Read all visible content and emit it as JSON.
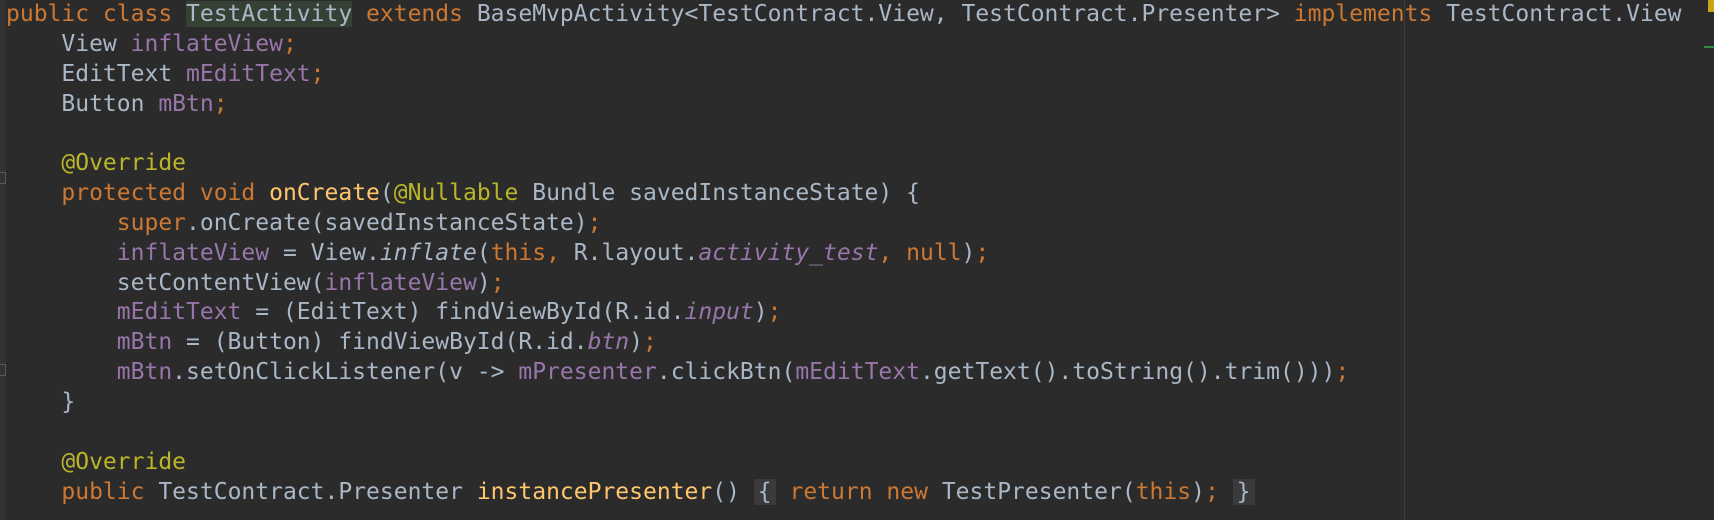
{
  "editor": {
    "caret_line": 1,
    "lines": [
      {
        "tokens": [
          {
            "t": "public class ",
            "c": "kw"
          },
          {
            "t": "",
            "c": "caret"
          },
          {
            "t": "TestActivity",
            "c": "hl-cls"
          },
          {
            "t": " extends ",
            "c": "kw"
          },
          {
            "t": "BaseMvpActivity<TestContract.View, TestContract.Presenter> ",
            "c": "plain"
          },
          {
            "t": "implements ",
            "c": "kw"
          },
          {
            "t": "TestContract.View",
            "c": "plain"
          }
        ]
      },
      {
        "tokens": [
          {
            "t": "    View ",
            "c": "plain"
          },
          {
            "t": "inflateView",
            "c": "fld"
          },
          {
            "t": ";",
            "c": "kw"
          }
        ]
      },
      {
        "tokens": [
          {
            "t": "    EditText ",
            "c": "plain"
          },
          {
            "t": "mEditText",
            "c": "fld"
          },
          {
            "t": ";",
            "c": "kw"
          }
        ]
      },
      {
        "tokens": [
          {
            "t": "    Button ",
            "c": "plain"
          },
          {
            "t": "mBtn",
            "c": "fld"
          },
          {
            "t": ";",
            "c": "kw"
          }
        ]
      },
      {
        "tokens": []
      },
      {
        "tokens": [
          {
            "t": "    @Override",
            "c": "ann"
          }
        ]
      },
      {
        "tokens": [
          {
            "t": "    protected void ",
            "c": "kw"
          },
          {
            "t": "onCreate",
            "c": "mth"
          },
          {
            "t": "(",
            "c": "plain"
          },
          {
            "t": "@Nullable",
            "c": "ann"
          },
          {
            "t": " Bundle savedInstanceState) {",
            "c": "plain"
          }
        ]
      },
      {
        "tokens": [
          {
            "t": "        super",
            "c": "kw"
          },
          {
            "t": ".onCreate(savedInstanceState)",
            "c": "plain"
          },
          {
            "t": ";",
            "c": "kw"
          }
        ]
      },
      {
        "tokens": [
          {
            "t": "        inflateView",
            "c": "fld"
          },
          {
            "t": " = View.",
            "c": "plain"
          },
          {
            "t": "inflate",
            "c": "smeth"
          },
          {
            "t": "(",
            "c": "plain"
          },
          {
            "t": "this",
            "c": "kw"
          },
          {
            "t": ", ",
            "c": "kw"
          },
          {
            "t": "R.layout.",
            "c": "plain"
          },
          {
            "t": "activity_test",
            "c": "stat"
          },
          {
            "t": ", ",
            "c": "kw"
          },
          {
            "t": "null",
            "c": "kw"
          },
          {
            "t": ")",
            "c": "plain"
          },
          {
            "t": ";",
            "c": "kw"
          }
        ]
      },
      {
        "tokens": [
          {
            "t": "        setContentView(",
            "c": "plain"
          },
          {
            "t": "inflateView",
            "c": "fld"
          },
          {
            "t": ")",
            "c": "plain"
          },
          {
            "t": ";",
            "c": "kw"
          }
        ]
      },
      {
        "tokens": [
          {
            "t": "        mEditText",
            "c": "fld"
          },
          {
            "t": " = (EditText) findViewById(R.id.",
            "c": "plain"
          },
          {
            "t": "input",
            "c": "stat"
          },
          {
            "t": ")",
            "c": "plain"
          },
          {
            "t": ";",
            "c": "kw"
          }
        ]
      },
      {
        "tokens": [
          {
            "t": "        mBtn",
            "c": "fld"
          },
          {
            "t": " = (Button) findViewById(R.id.",
            "c": "plain"
          },
          {
            "t": "btn",
            "c": "stat"
          },
          {
            "t": ")",
            "c": "plain"
          },
          {
            "t": ";",
            "c": "kw"
          }
        ]
      },
      {
        "tokens": [
          {
            "t": "        mBtn",
            "c": "fld"
          },
          {
            "t": ".setOnClickListener(v -> ",
            "c": "plain"
          },
          {
            "t": "mPresenter",
            "c": "fld"
          },
          {
            "t": ".clickBtn(",
            "c": "plain"
          },
          {
            "t": "mEditText",
            "c": "fld"
          },
          {
            "t": ".getText().toString().trim()))",
            "c": "plain"
          },
          {
            "t": ";",
            "c": "kw"
          }
        ]
      },
      {
        "tokens": [
          {
            "t": "    }",
            "c": "plain"
          }
        ]
      },
      {
        "tokens": []
      },
      {
        "tokens": [
          {
            "t": "    @Override",
            "c": "ann"
          }
        ]
      },
      {
        "tokens": [
          {
            "t": "    public ",
            "c": "kw"
          },
          {
            "t": "TestContract.Presenter ",
            "c": "plain"
          },
          {
            "t": "instancePresenter",
            "c": "mth"
          },
          {
            "t": "() ",
            "c": "plain"
          },
          {
            "t": "{",
            "c": "fold-brace"
          },
          {
            "t": " return new ",
            "c": "kw"
          },
          {
            "t": "TestPresenter(",
            "c": "plain"
          },
          {
            "t": "this",
            "c": "kw"
          },
          {
            "t": ")",
            "c": "plain"
          },
          {
            "t": "; ",
            "c": "kw"
          },
          {
            "t": "}",
            "c": "fold-brace"
          }
        ]
      }
    ]
  },
  "colors": {
    "background": "#2b2b2b",
    "keyword": "#cc7832",
    "field": "#9876aa",
    "annotation": "#bbb529",
    "method": "#ffc66d",
    "plain": "#a9b7c6"
  }
}
